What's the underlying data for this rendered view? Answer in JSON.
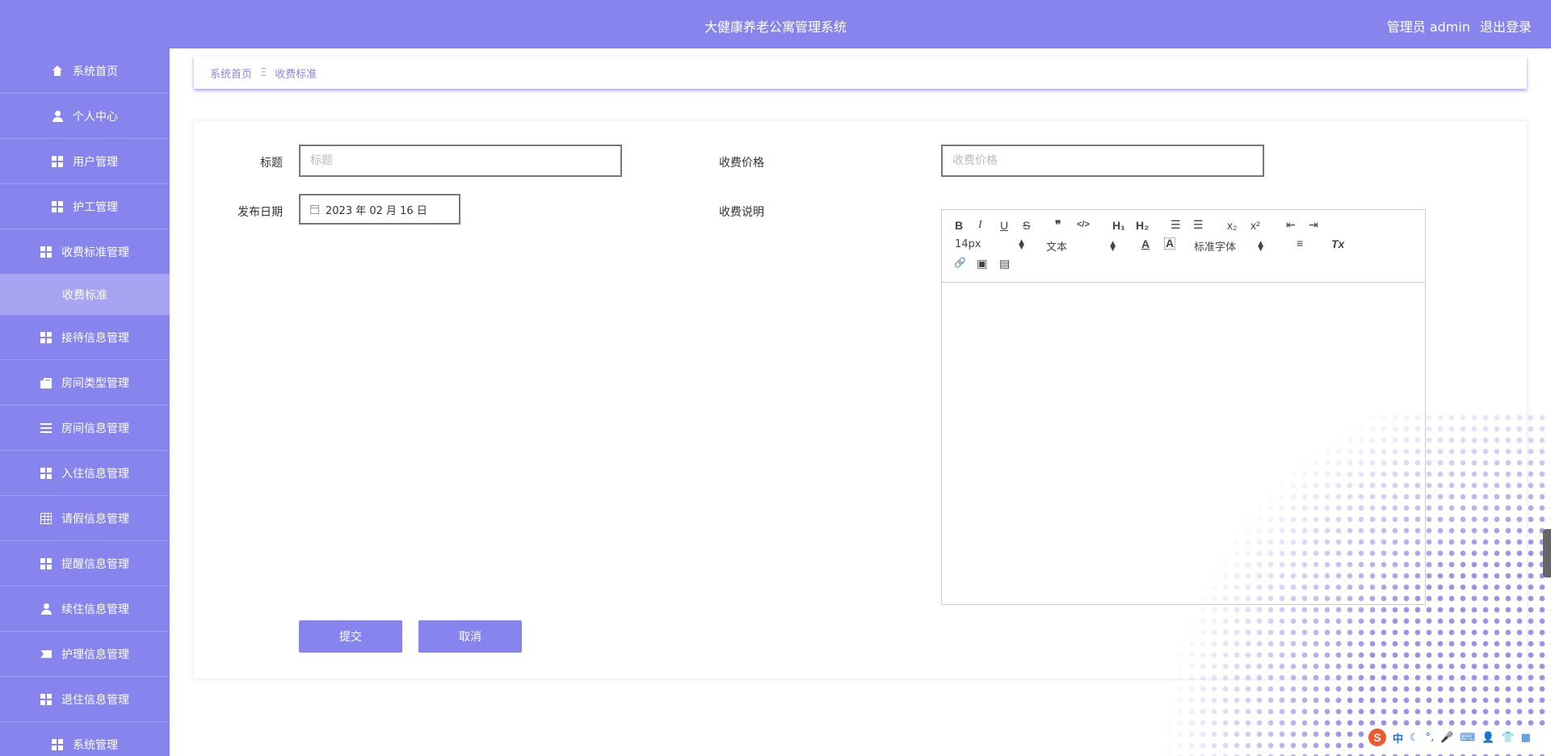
{
  "header": {
    "title": "大健康养老公寓管理系统",
    "role": "管理员 admin",
    "logout": "退出登录"
  },
  "sidebar": {
    "items": [
      {
        "label": "系统首页",
        "icon": "home-icon"
      },
      {
        "label": "个人中心",
        "icon": "user-icon"
      },
      {
        "label": "用户管理",
        "icon": "grid-icon"
      },
      {
        "label": "护工管理",
        "icon": "grid-icon"
      },
      {
        "label": "收费标准管理",
        "icon": "grid-icon"
      },
      {
        "label": "收费标准",
        "icon": ""
      },
      {
        "label": "接待信息管理",
        "icon": "grid-icon"
      },
      {
        "label": "房间类型管理",
        "icon": "briefcase-icon"
      },
      {
        "label": "房间信息管理",
        "icon": "list-icon"
      },
      {
        "label": "入住信息管理",
        "icon": "grid-icon"
      },
      {
        "label": "请假信息管理",
        "icon": "table-icon"
      },
      {
        "label": "提醒信息管理",
        "icon": "grid-icon"
      },
      {
        "label": "续住信息管理",
        "icon": "user-icon"
      },
      {
        "label": "护理信息管理",
        "icon": "ticket-icon"
      },
      {
        "label": "退住信息管理",
        "icon": "grid-icon"
      },
      {
        "label": "系统管理",
        "icon": "grid-icon"
      }
    ]
  },
  "breadcrumb": {
    "home": "系统首页",
    "separator": "Ξ",
    "current": "收费标准"
  },
  "form": {
    "title_label": "标题",
    "title_placeholder": "标题",
    "price_label": "收费价格",
    "price_placeholder": "收费价格",
    "date_label": "发布日期",
    "date_value": "2023 年 02 月 16 日",
    "desc_label": "收费说明",
    "submit": "提交",
    "cancel": "取消"
  },
  "editor": {
    "bold": "B",
    "italic": "I",
    "underline": "U",
    "strike": "S",
    "quote": "❞",
    "code": "</>",
    "h1": "H₁",
    "h2": "H₂",
    "ordered_list": "☰",
    "bullet_list": "☰",
    "sub": "x₂",
    "sup": "x²",
    "outdent": "⇤",
    "indent": "⇥",
    "size_value": "14px",
    "header_value": "文本",
    "color": "A",
    "background": "A",
    "font_value": "标准字体",
    "align": "≡",
    "clean": "Tx",
    "link": "🔗",
    "image": "▣",
    "video": "▤"
  },
  "tray": {
    "ime": "S",
    "lang": "中",
    "items": [
      "☾",
      "°,",
      "🎤",
      "⌨",
      "👤",
      "👕",
      "▦"
    ]
  }
}
